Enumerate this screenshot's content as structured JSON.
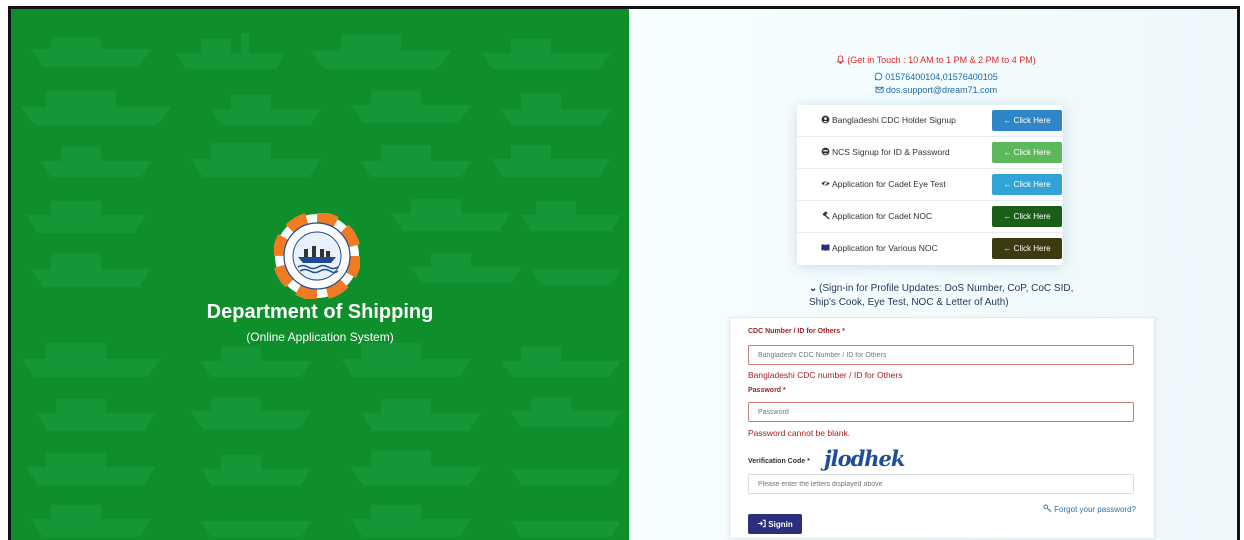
{
  "left": {
    "title": "Department of Shipping",
    "subtitle": "(Online Application System)"
  },
  "contact": {
    "hours": "(Get in Touch : 10 AM to 1 PM & 2 PM to 4 PM)",
    "phone": "01576400104,01576400105",
    "email": "dos.support@dream71.com"
  },
  "links": [
    {
      "label": "Bangladeshi CDC Holder Signup",
      "button": "← Click Here",
      "icon": "user-circle-icon",
      "color": "#2f86c7"
    },
    {
      "label": "NCS Signup for ID & Password",
      "button": "← Click Here",
      "icon": "user-secret-icon",
      "color": "#5cb85c"
    },
    {
      "label": "Application for Cadet Eye Test",
      "button": "← Click Here",
      "icon": "eye-slash-icon",
      "color": "#31a3d6"
    },
    {
      "label": "Application for Cadet NOC",
      "button": "← Click Here",
      "icon": "gavel-icon",
      "color": "#1a5e1a"
    },
    {
      "label": "Application for Various NOC",
      "button": "← Click Here",
      "icon": "book-icon",
      "color": "#3b3a10"
    }
  ],
  "signin_note": "(Sign-in for Profile Updates: DoS Number, CoP, CoC SID, Ship's Cook, Eye Test, NOC & Letter of Auth)",
  "form": {
    "cdc_label": "CDC Number / ID for Others",
    "cdc_placeholder": "Bangladeshi CDC Number / ID for Others",
    "cdc_error": "Bangladeshi CDC number / ID for Others",
    "password_label": "Password",
    "password_placeholder": "Password",
    "password_error": "Password cannot be blank.",
    "verification_label": "Verification Code",
    "captcha_text": "jlodhek",
    "verification_placeholder": "Please enter the letters displayed above",
    "forgot_link": "Forgot your password?",
    "signin_button": "Signin",
    "required_mark": "*"
  },
  "colors": {
    "left_bg": "#0f8f2c",
    "signin_btn": "#2a2f7e",
    "error": "#a02323"
  }
}
